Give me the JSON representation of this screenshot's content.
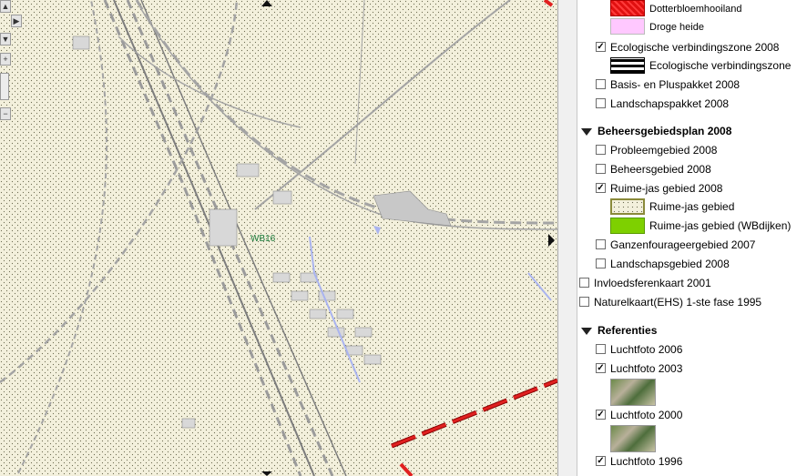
{
  "map": {
    "label": "WB16",
    "colors": {
      "background": "#f3f0dc",
      "road": "#a0a0a0",
      "rail": "#8a8a8a",
      "water": "#aab4f0",
      "dike": "#c41414"
    }
  },
  "legend": {
    "rows": [
      {
        "kind": "swatch",
        "label": "Dotterbloemhooiland",
        "swatch": "red-pattern"
      },
      {
        "kind": "swatch",
        "label": "Droge heide",
        "swatch": "pink"
      },
      {
        "kind": "check",
        "label": "Ecologische verbindingszone 2008",
        "checked": true
      },
      {
        "kind": "swatch",
        "label": "Ecologische verbindingszone",
        "swatch": "black-lines"
      },
      {
        "kind": "check",
        "label": "Basis- en Pluspakket 2008",
        "checked": false
      },
      {
        "kind": "check",
        "label": "Landschapspakket 2008",
        "checked": false
      },
      {
        "kind": "group",
        "label": "Beheersgebiedsplan 2008"
      },
      {
        "kind": "check",
        "label": "Probleemgebied 2008",
        "checked": false
      },
      {
        "kind": "check",
        "label": "Beheersgebied 2008",
        "checked": false
      },
      {
        "kind": "check",
        "label": "Ruime-jas gebied 2008",
        "checked": true
      },
      {
        "kind": "swatch",
        "label": "Ruime-jas gebied",
        "swatch": "dotted"
      },
      {
        "kind": "swatch",
        "label": "Ruime-jas gebied (WBdijken)",
        "swatch": "green"
      },
      {
        "kind": "check",
        "label": "Ganzenfourageergebied 2007",
        "checked": false
      },
      {
        "kind": "check",
        "label": "Landschapsgebied 2008",
        "checked": false
      },
      {
        "kind": "check",
        "label": "Invloedsferenkaart 2001",
        "checked": false
      },
      {
        "kind": "check",
        "label": "Naturelkaart(EHS) 1-ste fase 1995",
        "checked": false
      },
      {
        "kind": "group",
        "label": "Referenties"
      },
      {
        "kind": "check",
        "label": "Luchtfoto 2006",
        "checked": false
      },
      {
        "kind": "check",
        "label": "Luchtfoto 2003",
        "checked": true
      },
      {
        "kind": "thumb",
        "label": ""
      },
      {
        "kind": "check",
        "label": "Luchtfoto 2000",
        "checked": true
      },
      {
        "kind": "thumb",
        "label": ""
      },
      {
        "kind": "check",
        "label": "Luchtfoto 1996",
        "checked": true
      }
    ]
  }
}
